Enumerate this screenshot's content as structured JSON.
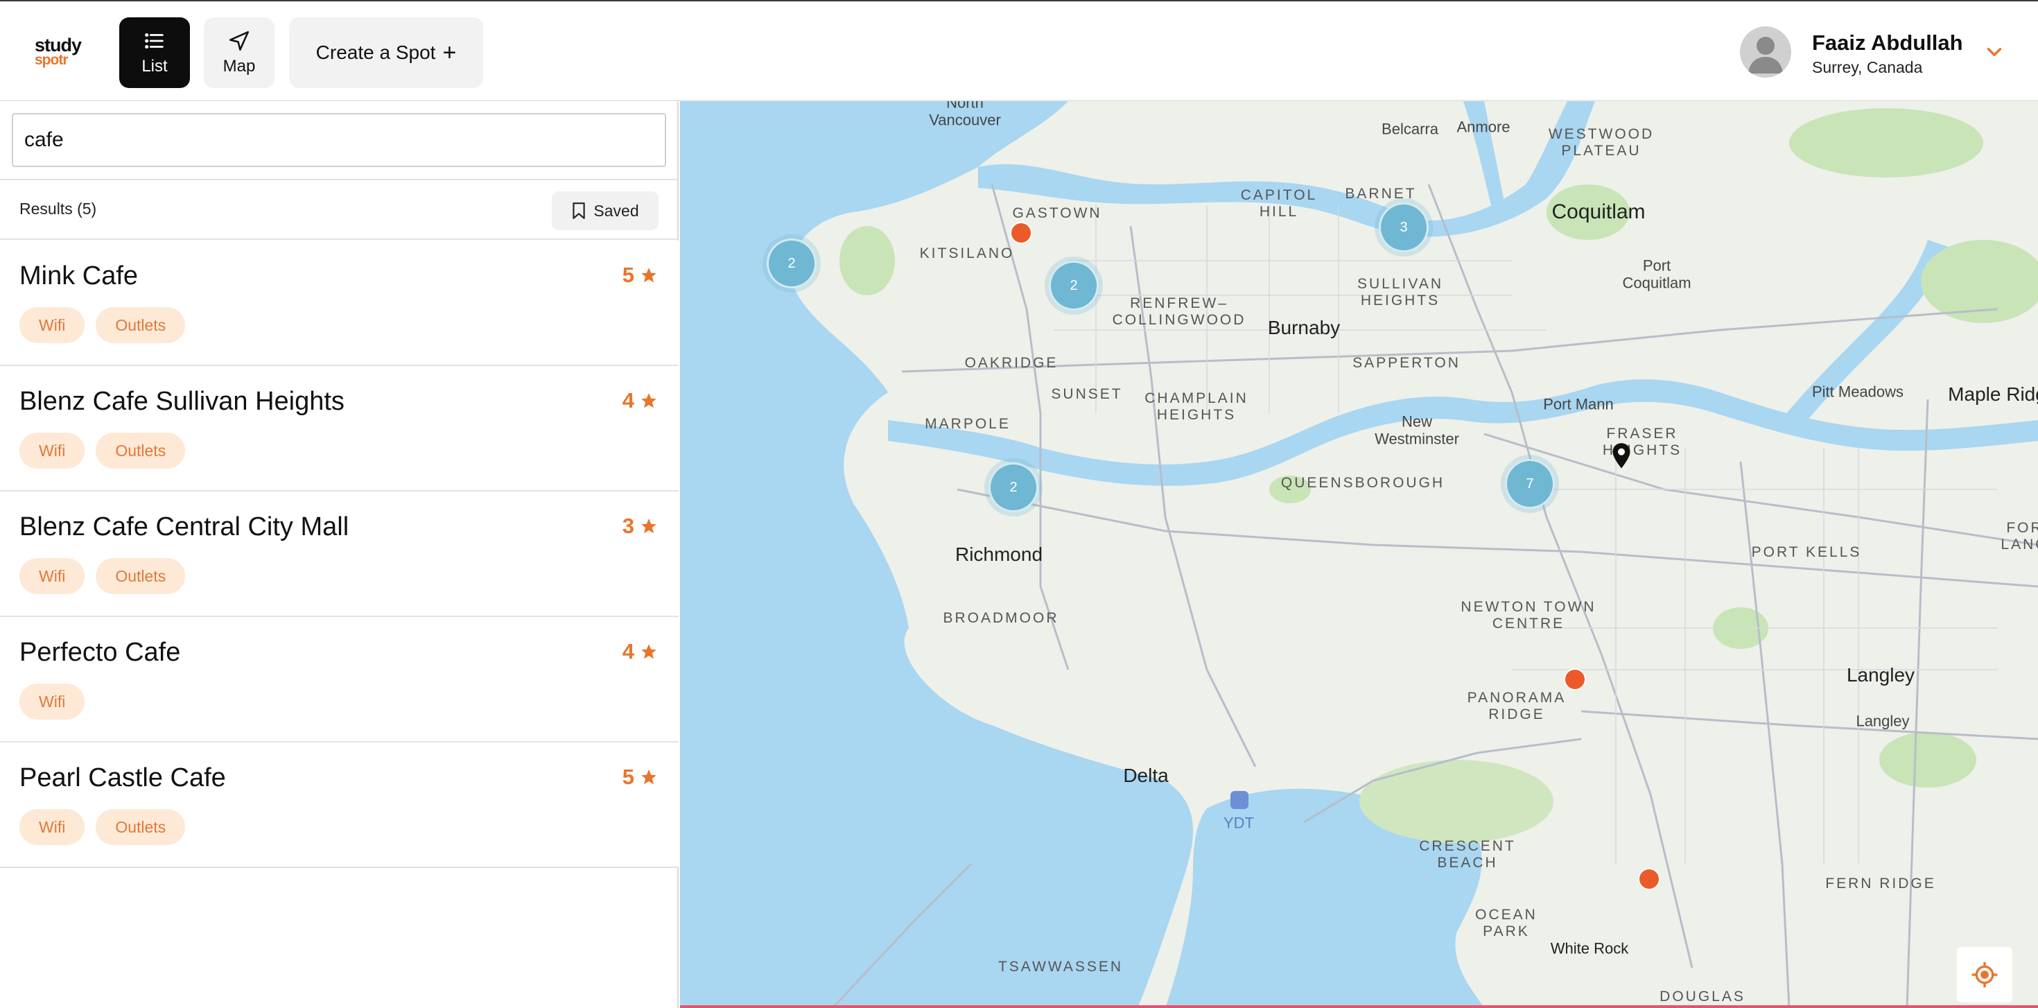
{
  "app": {
    "logo_top": "study",
    "logo_bottom": "spotr"
  },
  "nav": {
    "list_label": "List",
    "map_label": "Map",
    "create_label": "Create a Spot",
    "create_icon": "+"
  },
  "user": {
    "name": "Faaiz Abdullah",
    "location": "Surrey, Canada"
  },
  "search": {
    "value": "cafe"
  },
  "results": {
    "count_label": "Results (5)",
    "saved_label": "Saved"
  },
  "spots": [
    {
      "name": "Mink Cafe",
      "rating": "5",
      "tags": [
        "Wifi",
        "Outlets"
      ]
    },
    {
      "name": "Blenz Cafe Sullivan Heights",
      "rating": "4",
      "tags": [
        "Wifi",
        "Outlets"
      ]
    },
    {
      "name": "Blenz Cafe Central City Mall",
      "rating": "3",
      "tags": [
        "Wifi",
        "Outlets"
      ]
    },
    {
      "name": "Perfecto Cafe",
      "rating": "4",
      "tags": [
        "Wifi"
      ]
    },
    {
      "name": "Pearl Castle Cafe",
      "rating": "5",
      "tags": [
        "Wifi",
        "Outlets"
      ]
    }
  ],
  "map": {
    "labels": {
      "north_vancouver": "North\nVancouver",
      "belcarra": "Belcarra",
      "anmore": "Anmore",
      "westwood_plateau": "WESTWOOD\nPLATEAU",
      "gastown": "GASTOWN",
      "capitol_hill": "CAPITOL\nHILL",
      "barnet": "BARNET",
      "coquitlam": "Coquitlam",
      "kitsilano": "KITSILANO",
      "port_coquitlam": "Port\nCoquitlam",
      "renfrew": "RENFREW–\nCOLLINGWOOD",
      "burnaby": "Burnaby",
      "sullivan_heights": "SULLIVAN\nHEIGHTS",
      "oakridge": "OAKRIDGE",
      "sapperton": "SAPPERTON",
      "sunset": "SUNSET",
      "champlain": "CHAMPLAIN\nHEIGHTS",
      "pitt_meadows": "Pitt Meadows",
      "maple_ridge": "Maple Ridg",
      "marpole": "MARPOLE",
      "new_westminster": "New\nWestminster",
      "port_mann": "Port Mann",
      "fraser_heights": "FRASER\nHEIGHTS",
      "queensborough": "QUEENSBOROUGH",
      "richmond": "Richmond",
      "port_kells": "PORT KELLS",
      "fort_langley": "FOR\nLANG",
      "broadmoor": "BROADMOOR",
      "newton": "NEWTON TOWN\nCENTRE",
      "langley_city": "Langley",
      "langley": "Langley",
      "panorama": "PANORAMA\nRIDGE",
      "delta": "Delta",
      "ydt": "YDT",
      "crescent_beach": "CRESCENT\nBEACH",
      "fern_ridge": "FERN RIDGE",
      "ocean_park": "OCEAN\nPARK",
      "white_rock": "White Rock",
      "tsawwassen": "TSAWWASSEN",
      "douglas": "DOUGLAS"
    },
    "clusters": [
      {
        "count": "2"
      },
      {
        "count": "2"
      },
      {
        "count": "3"
      },
      {
        "count": "2"
      },
      {
        "count": "7"
      }
    ],
    "colors": {
      "water": "#a9d6f1",
      "land": "#eef0ea",
      "park": "#c9e4b7",
      "cluster": "#6fb7d3",
      "spot_pin": "#ec5a2a",
      "accent": "#e8752b"
    }
  }
}
